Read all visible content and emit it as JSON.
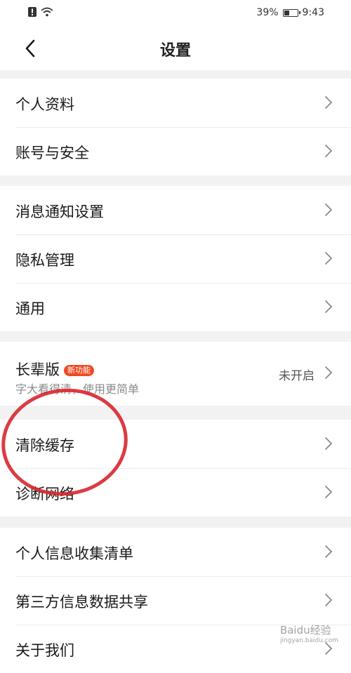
{
  "status_bar": {
    "battery_percent": "39%",
    "time": "9:43",
    "battery_level": 0.39
  },
  "nav": {
    "title": "设置"
  },
  "groups": [
    {
      "items": [
        {
          "label": "个人资料"
        },
        {
          "label": "账号与安全"
        }
      ]
    },
    {
      "items": [
        {
          "label": "消息通知设置"
        },
        {
          "label": "隐私管理"
        },
        {
          "label": "通用"
        }
      ]
    },
    {
      "items": [
        {
          "label": "长辈版",
          "badge": "新功能",
          "subtitle": "字大看得清，使用更简单",
          "value": "未开启"
        }
      ]
    },
    {
      "items": [
        {
          "label": "清除缓存"
        },
        {
          "label": "诊断网络"
        }
      ]
    },
    {
      "items": [
        {
          "label": "个人信息收集清单"
        },
        {
          "label": "第三方信息数据共享"
        },
        {
          "label": "关于我们"
        }
      ]
    }
  ],
  "watermark": {
    "text": "Baidu经验",
    "url": "jingyan.baidu.com"
  },
  "colors": {
    "annotation_circle": "#d8262d",
    "badge": "#f04a23"
  }
}
